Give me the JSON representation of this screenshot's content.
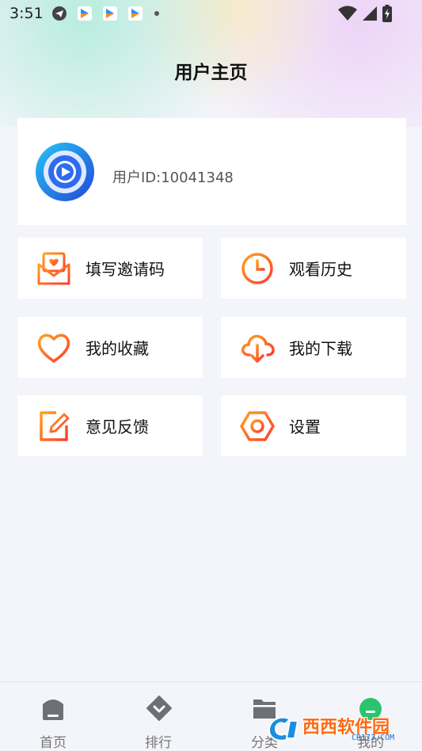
{
  "status_bar": {
    "time": "3:51"
  },
  "page_title": "用户主页",
  "profile": {
    "user_id": "用户ID:10041348"
  },
  "menu": [
    {
      "label": "填写邀请码",
      "icon": "mail-heart-icon"
    },
    {
      "label": "观看历史",
      "icon": "clock-icon"
    },
    {
      "label": "我的收藏",
      "icon": "heart-icon"
    },
    {
      "label": "我的下载",
      "icon": "cloud-download-icon"
    },
    {
      "label": "意见反馈",
      "icon": "edit-note-icon"
    },
    {
      "label": "设置",
      "icon": "hexagon-settings-icon"
    }
  ],
  "bottom_nav": [
    {
      "label": "首页",
      "icon": "home-icon"
    },
    {
      "label": "排行",
      "icon": "diamond-rank-icon"
    },
    {
      "label": "分类",
      "icon": "folder-icon"
    },
    {
      "label": "我的",
      "icon": "profile-icon"
    }
  ],
  "watermark": {
    "text": "西西软件园",
    "sub": "CR173.COM"
  },
  "colors": {
    "accent_start": "#ff9a1f",
    "accent_end": "#ff3d2e",
    "avatar_blue": "#2d6cf0"
  }
}
